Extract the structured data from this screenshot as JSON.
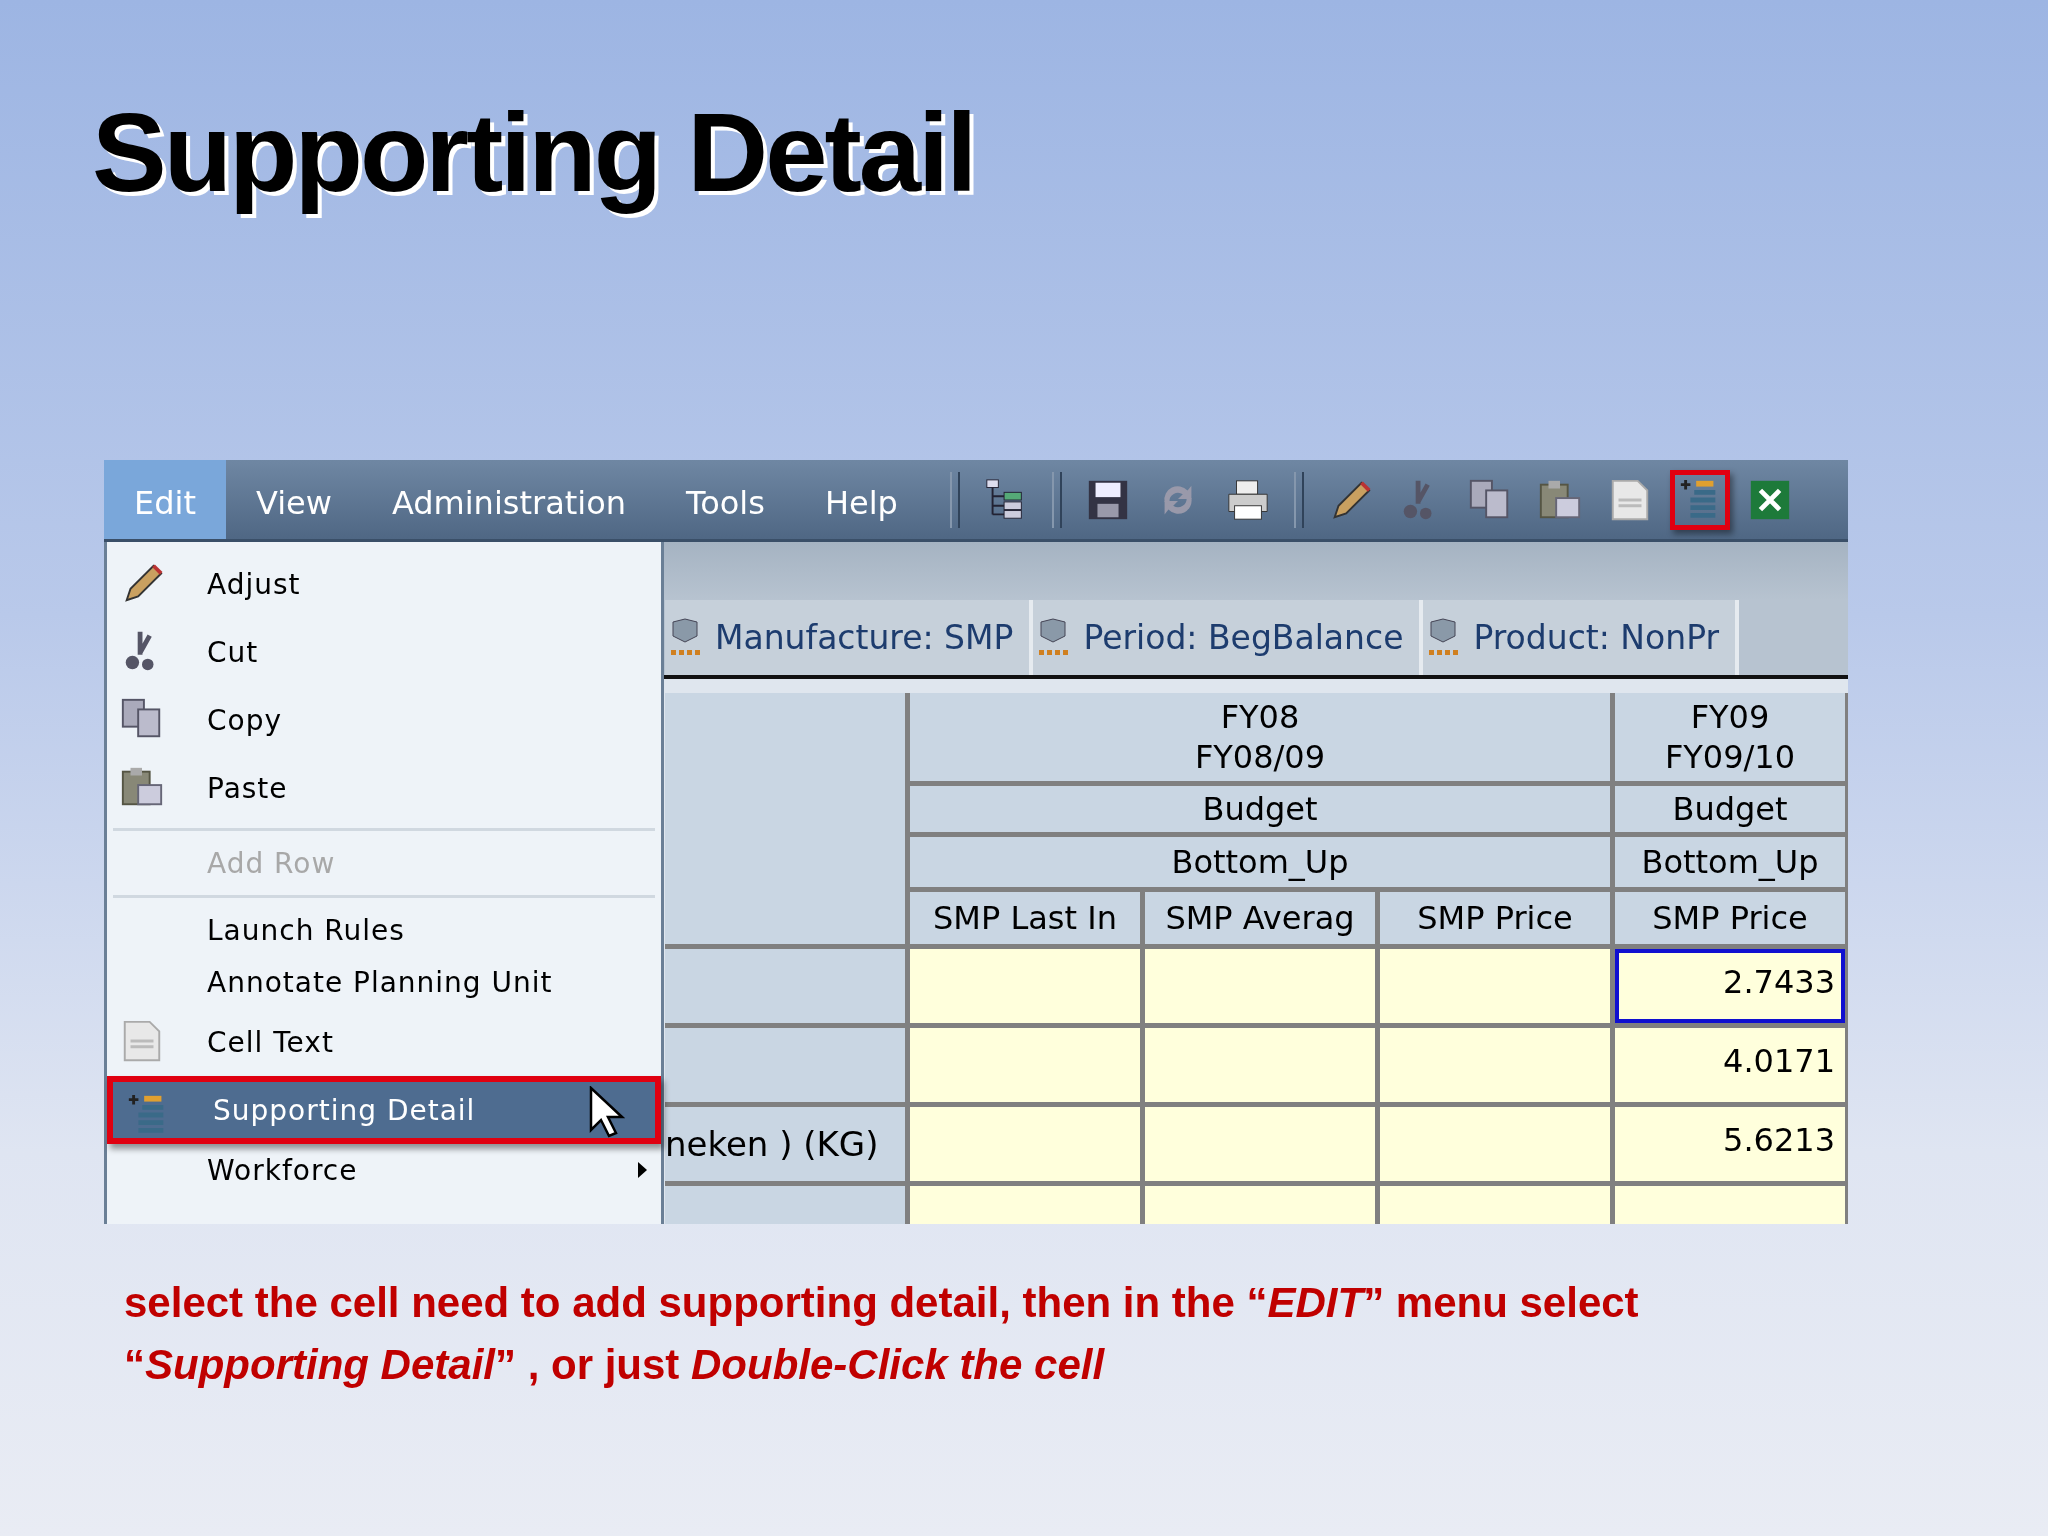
{
  "slide_title": "Supporting Detail",
  "app": {
    "menu_bar": [
      {
        "label": "Edit",
        "selected": true
      },
      {
        "label": "View",
        "selected": false
      },
      {
        "label": "Administration",
        "selected": false
      },
      {
        "label": "Tools",
        "selected": false
      },
      {
        "label": "Help",
        "selected": false
      }
    ],
    "toolbar": [
      {
        "kind": "separator"
      },
      {
        "kind": "tree",
        "highlighted": false
      },
      {
        "kind": "separator"
      },
      {
        "kind": "save",
        "highlighted": false
      },
      {
        "kind": "refresh",
        "highlighted": false
      },
      {
        "kind": "print",
        "highlighted": false
      },
      {
        "kind": "separator"
      },
      {
        "kind": "pencil",
        "highlighted": false
      },
      {
        "kind": "scissors",
        "highlighted": false
      },
      {
        "kind": "copy",
        "highlighted": false
      },
      {
        "kind": "paste",
        "highlighted": false
      },
      {
        "kind": "abc",
        "highlighted": false
      },
      {
        "kind": "detail",
        "highlighted": true
      },
      {
        "kind": "excel",
        "highlighted": false
      }
    ],
    "pov": [
      "Manufacture: SMP",
      "Period: BegBalance",
      "Product: NonPr"
    ],
    "grid": {
      "column_groups": [
        {
          "year": "FY08",
          "fiscal_year": "FY08/09",
          "scenario": "Budget",
          "version": "Bottom_Up",
          "members": [
            "SMP Last In",
            "SMP Averag",
            "SMP Price"
          ]
        },
        {
          "year": "FY09",
          "fiscal_year": "FY09/10",
          "scenario": "Budget",
          "version": "Bottom_Up",
          "members": [
            "SMP Price"
          ]
        }
      ],
      "rows": [
        {
          "cells": [
            {
              "selected": false
            },
            {
              "selected": false
            },
            {
              "selected": false
            },
            {
              "value": "2.7433",
              "selected": true
            }
          ]
        },
        {
          "cells": [
            {
              "selected": false
            },
            {
              "selected": false
            },
            {
              "selected": false
            },
            {
              "value": "4.0171",
              "selected": false
            }
          ]
        },
        {
          "header": "neken ) (KG)",
          "cells": [
            {
              "selected": false
            },
            {
              "selected": false
            },
            {
              "selected": false
            },
            {
              "value": "5.6213",
              "selected": false
            }
          ]
        },
        {
          "cells": [
            {
              "selected": false
            },
            {
              "selected": false
            },
            {
              "selected": false
            },
            {
              "selected": false
            }
          ]
        }
      ]
    },
    "edit_menu": [
      {
        "kind": "pencil",
        "label": "Adjust",
        "disabled": false,
        "selected": false,
        "highlighted": false,
        "submenu": false
      },
      {
        "kind": "scissors",
        "label": "Cut",
        "disabled": false,
        "selected": false,
        "highlighted": false,
        "submenu": false
      },
      {
        "kind": "copy",
        "label": "Copy",
        "disabled": false,
        "selected": false,
        "highlighted": false,
        "submenu": false
      },
      {
        "kind": "paste",
        "label": "Paste",
        "disabled": false,
        "selected": false,
        "highlighted": false,
        "submenu": false
      },
      {
        "kind": "separator"
      },
      {
        "kind": "text",
        "label": "Add Row",
        "disabled": true,
        "selected": false,
        "highlighted": false,
        "submenu": false
      },
      {
        "kind": "separator"
      },
      {
        "kind": "text",
        "label": "Launch Rules",
        "disabled": false,
        "selected": false,
        "highlighted": false,
        "submenu": false
      },
      {
        "kind": "text",
        "label": "Annotate Planning Unit",
        "disabled": false,
        "selected": false,
        "highlighted": false,
        "submenu": false
      },
      {
        "kind": "abc",
        "label": "Cell Text",
        "disabled": false,
        "selected": false,
        "highlighted": false,
        "submenu": false
      },
      {
        "kind": "detail",
        "label": "Supporting Detail",
        "disabled": false,
        "selected": true,
        "highlighted": true,
        "submenu": false
      },
      {
        "kind": "text",
        "label": "Workforce",
        "disabled": false,
        "selected": false,
        "highlighted": false,
        "submenu": true
      }
    ]
  },
  "caption": "select the cell need to add supporting detail, then in the “*EDIT*” menu  select “*Supporting Detail*” , or just *Double-Click the cell*"
}
